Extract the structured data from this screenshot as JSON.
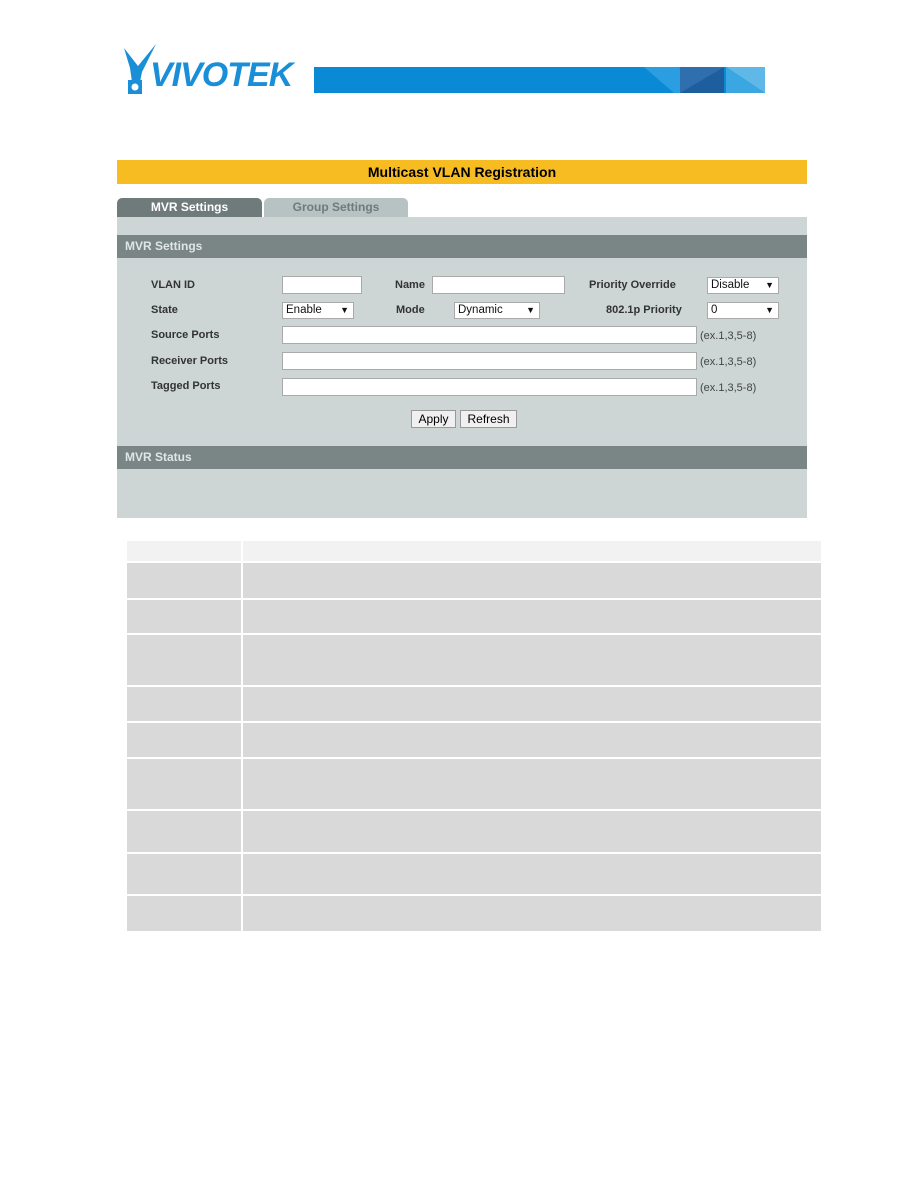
{
  "logo": {
    "text": "VIVOTEK",
    "brand_color": "#0a8ad4"
  },
  "title": "Multicast VLAN Registration",
  "tabs": [
    {
      "label": "MVR Settings",
      "active": true
    },
    {
      "label": "Group Settings",
      "active": false
    }
  ],
  "settings": {
    "header": "MVR Settings",
    "vlan_id": {
      "label": "VLAN ID",
      "value": ""
    },
    "name": {
      "label": "Name",
      "value": ""
    },
    "priority_override": {
      "label": "Priority Override",
      "value": "Disable"
    },
    "state": {
      "label": "State",
      "value": "Enable"
    },
    "mode": {
      "label": "Mode",
      "value": "Dynamic"
    },
    "priority_8021p": {
      "label": "802.1p Priority",
      "value": "0"
    },
    "source_ports": {
      "label": "Source Ports",
      "value": "",
      "hint": "(ex.1,3,5-8)"
    },
    "receiver_ports": {
      "label": "Receiver Ports",
      "value": "",
      "hint": "(ex.1,3,5-8)"
    },
    "tagged_ports": {
      "label": "Tagged Ports",
      "value": "",
      "hint": "(ex.1,3,5-8)"
    },
    "apply": "Apply",
    "refresh": "Refresh"
  },
  "status": {
    "header": "MVR Status"
  },
  "table": {
    "rows": 10
  }
}
